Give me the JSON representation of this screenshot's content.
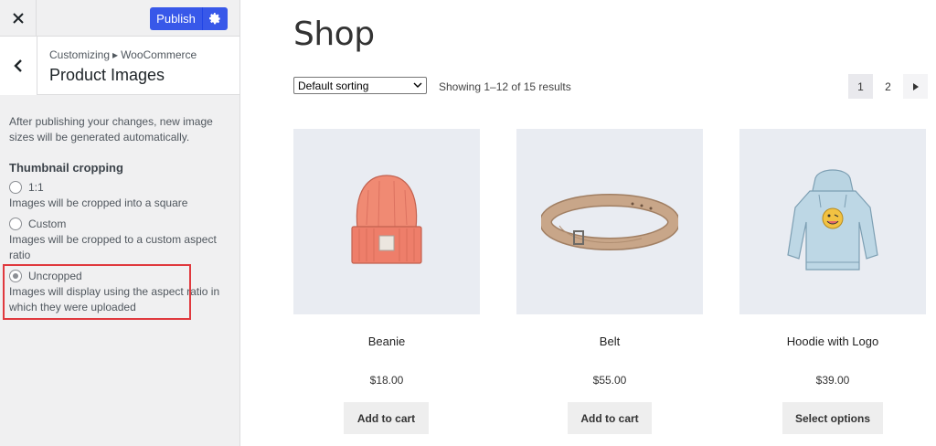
{
  "customizer": {
    "close_icon": "close-icon",
    "publish_label": "Publish",
    "settings_icon": "gear-icon",
    "back_icon": "chevron-left-icon",
    "breadcrumb": {
      "root": "Customizing",
      "separator": "▸",
      "parent": "WooCommerce"
    },
    "section_title": "Product Images",
    "notice": "After publishing your changes, new image sizes will be generated automatically.",
    "cropping": {
      "title": "Thumbnail cropping",
      "options": [
        {
          "label": "1:1",
          "description": "Images will be cropped into a square",
          "selected": false
        },
        {
          "label": "Custom",
          "description": "Images will be cropped to a custom aspect ratio",
          "selected": false
        },
        {
          "label": "Uncropped",
          "description": "Images will display using the aspect ratio in which they were uploaded",
          "selected": true
        }
      ]
    },
    "accent_color": "#3858e9",
    "highlight_color": "#e0393e"
  },
  "shop": {
    "title": "Shop",
    "sorting": "Default sorting",
    "results": "Showing 1–12 of 15 results",
    "pagination": {
      "pages": [
        "1",
        "2"
      ],
      "current": "1",
      "next_icon": "triangle-right-icon"
    },
    "products": [
      {
        "name": "Beanie",
        "price": "$18.00",
        "button": "Add to cart",
        "image_icon": "beanie-image"
      },
      {
        "name": "Belt",
        "price": "$55.00",
        "button": "Add to cart",
        "image_icon": "belt-image"
      },
      {
        "name": "Hoodie with Logo",
        "price": "$39.00",
        "button": "Select options",
        "image_icon": "hoodie-image"
      }
    ]
  }
}
